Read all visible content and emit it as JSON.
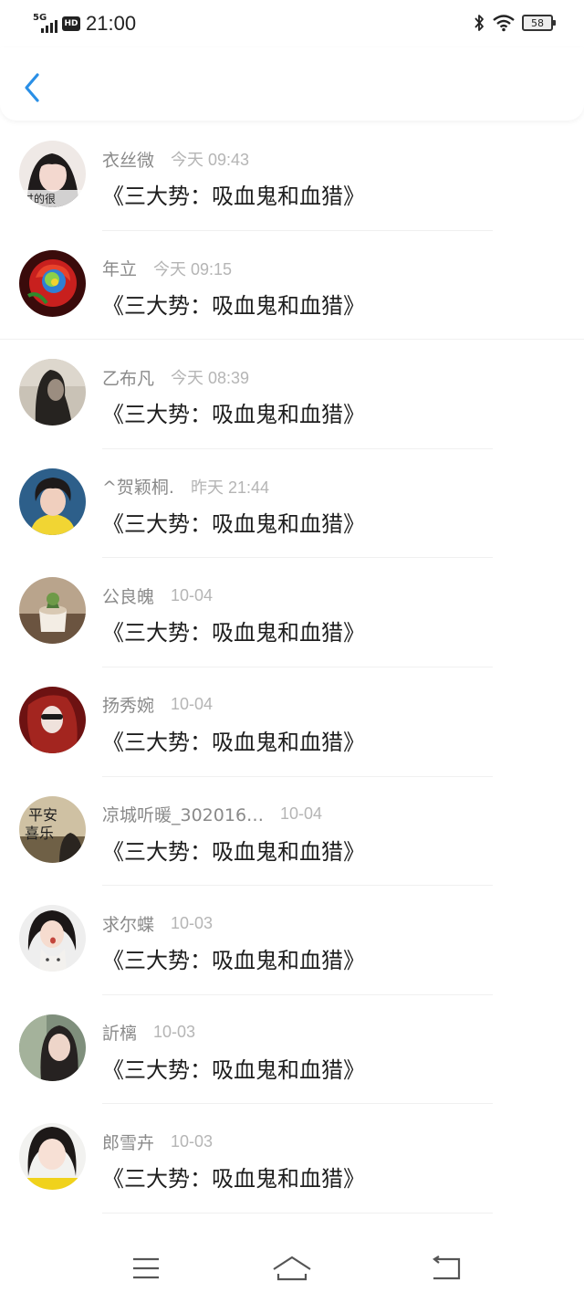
{
  "status_bar": {
    "network": "5G",
    "hd": "HD",
    "time": "21:00",
    "battery": "58",
    "icons": [
      "bluetooth-icon",
      "wifi-icon",
      "battery-icon"
    ]
  },
  "nav": {
    "back_icon": "chevron-left-icon",
    "accent": "#2a8fe6"
  },
  "comments": [
    {
      "name": "衣丝微",
      "time": "今天 09:43",
      "title": "《三大势：吸血鬼和血猎》",
      "avatar": "avatar-icon"
    },
    {
      "name": "年立",
      "time": "今天 09:15",
      "title": "《三大势：吸血鬼和血猎》",
      "avatar": "avatar-icon"
    },
    {
      "name": "乙布凡",
      "time": "今天 08:39",
      "title": "《三大势：吸血鬼和血猎》",
      "avatar": "avatar-icon"
    },
    {
      "name": "^贺颖桐.",
      "time": "昨天 21:44",
      "title": "《三大势：吸血鬼和血猎》",
      "avatar": "avatar-icon"
    },
    {
      "name": "公良魄",
      "time": "10-04",
      "title": "《三大势：吸血鬼和血猎》",
      "avatar": "avatar-icon"
    },
    {
      "name": "扬秀婉",
      "time": "10-04",
      "title": "《三大势：吸血鬼和血猎》",
      "avatar": "avatar-icon"
    },
    {
      "name": "凉城听暖_302016…",
      "time": "10-04",
      "title": "《三大势：吸血鬼和血猎》",
      "avatar": "avatar-icon"
    },
    {
      "name": "求尔蝶",
      "time": "10-03",
      "title": "《三大势：吸血鬼和血猎》",
      "avatar": "avatar-icon"
    },
    {
      "name": "訢樆",
      "time": "10-03",
      "title": "《三大势：吸血鬼和血猎》",
      "avatar": "avatar-icon"
    },
    {
      "name": "郎雪卉",
      "time": "10-03",
      "title": "《三大势：吸血鬼和血猎》",
      "avatar": "avatar-icon"
    }
  ],
  "bottom_nav": [
    "menu-icon",
    "home-icon",
    "back-icon"
  ]
}
